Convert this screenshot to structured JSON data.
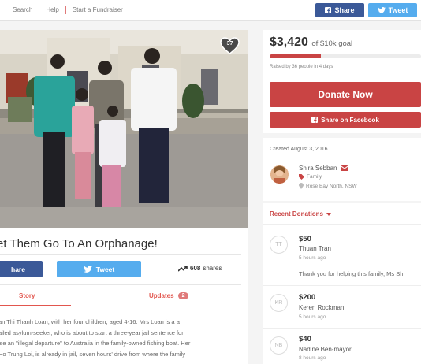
{
  "nav": {
    "search": "Search",
    "help": "Help",
    "start": "Start a Fundraiser"
  },
  "top_share": {
    "facebook": "Share",
    "twitter": "Tweet"
  },
  "campaign": {
    "title": "et Them Go To An Orphanage!",
    "hearts": "37",
    "share_facebook": "hare",
    "share_twitter": "Tweet",
    "shares_count": "608",
    "shares_label": "shares",
    "tab_story": "Story",
    "tab_updates": "Updates",
    "updates_count": "2",
    "story_lines": [
      "an Thi Thanh Loan, with her four children, aged 4-16. Mrs Loan is a a",
      "ailed asylum-seeker, who is about to start a three-year jail sentence for",
      "ise an \"illegal departure\" to Australia in the family-owned fishing boat. Her",
      "Ho Trung Loi, is already in jail, seven hours' drive from where the family"
    ]
  },
  "fundraiser": {
    "amount": "$3,420",
    "goal_text": "of $10k goal",
    "progress": 0.34,
    "raised_by": "Raised by 36 people in 4 days",
    "donate_label": "Donate Now",
    "fb_share_label": "Share on Facebook",
    "created": "Created August 3, 2016",
    "organizer_name": "Shira Sebban",
    "category": "Family",
    "location": "Rose Bay North, NSW",
    "recent_label": "Recent Donations"
  },
  "donations": [
    {
      "initials": "TT",
      "amount": "$50",
      "name": "Thuan Tran",
      "time": "5 hours ago",
      "message": "Thank you for helping this family, Ms Sh"
    },
    {
      "initials": "KR",
      "amount": "$200",
      "name": "Keren Rockman",
      "time": "5 hours ago",
      "message": ""
    },
    {
      "initials": "NB",
      "amount": "$40",
      "name": "Nadine Ben-mayor",
      "time": "8 hours ago",
      "message": ""
    }
  ],
  "colors": {
    "brand_red": "#c94444",
    "facebook": "#3b5998",
    "twitter": "#55acee"
  }
}
